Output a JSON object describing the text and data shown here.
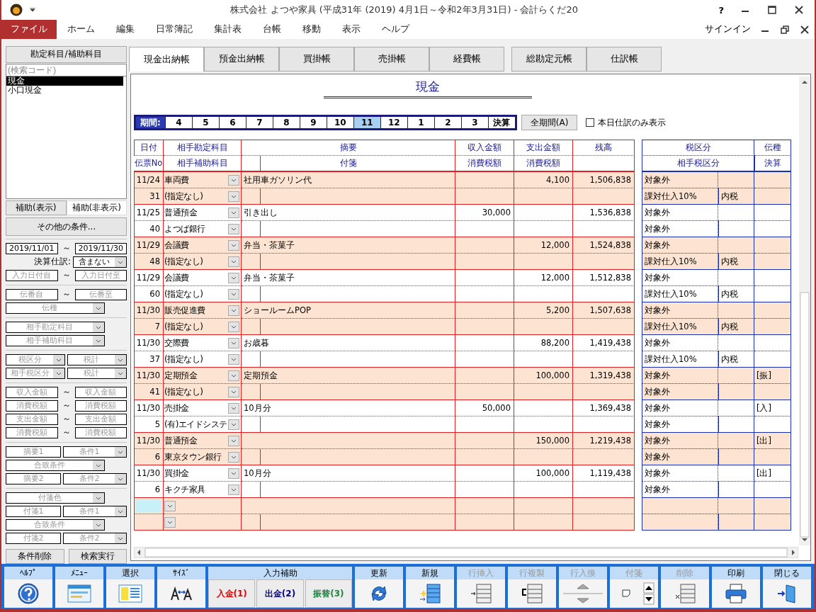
{
  "window": {
    "title": "株式会社 よつや家具 (平成31年 (2019) 4月1日～令和2年3月31日) - 会計らくだ20",
    "help": "?"
  },
  "menu": [
    {
      "label": "ファイル",
      "selected": true
    },
    {
      "label": "ホーム",
      "selected": false
    },
    {
      "label": "編集",
      "selected": false
    },
    {
      "label": "日常簿記",
      "selected": false
    },
    {
      "label": "集計表",
      "selected": false
    },
    {
      "label": "台帳",
      "selected": false
    },
    {
      "label": "移動",
      "selected": false
    },
    {
      "label": "表示",
      "selected": false
    },
    {
      "label": "ヘルプ",
      "selected": false
    }
  ],
  "signin": "サインイン",
  "sidebar": {
    "header": "勘定科目/補助科目",
    "search_placeholder": "(検索コード)",
    "accounts": [
      {
        "label": "現金",
        "selected": true
      },
      {
        "label": "小口現金",
        "selected": false
      }
    ],
    "sub_tabs": [
      {
        "label": "補助(表示)",
        "selected": false
      },
      {
        "label": "補助(非表示)",
        "selected": true
      }
    ],
    "more_button": "その他の条件...",
    "filter_groups": [
      [
        [
          {
            "kind": "date",
            "value": "2019/11/01"
          },
          {
            "kind": "tilde",
            "text": "～"
          },
          {
            "kind": "date",
            "value": "2019/11/30"
          }
        ],
        [
          {
            "kind": "label",
            "text": "決算仕訳:"
          },
          {
            "kind": "combo",
            "value": "含まない"
          }
        ],
        [
          {
            "kind": "text",
            "placeholder": "入力日付自"
          },
          {
            "kind": "tilde",
            "text": "～"
          },
          {
            "kind": "text",
            "placeholder": "入力日付至"
          }
        ]
      ],
      [
        [
          {
            "kind": "text",
            "placeholder": "伝番自"
          },
          {
            "kind": "tilde",
            "text": "～"
          },
          {
            "kind": "text",
            "placeholder": "伝番至"
          }
        ],
        [
          {
            "kind": "combo",
            "placeholder": "伝種"
          }
        ]
      ],
      [
        [
          {
            "kind": "combo",
            "placeholder": "相手勘定科目"
          }
        ],
        [
          {
            "kind": "combo",
            "placeholder": "相手補助科目"
          }
        ]
      ],
      [
        [
          {
            "kind": "combo",
            "placeholder": "税区分"
          },
          {
            "kind": "combo",
            "placeholder": "税計"
          }
        ],
        [
          {
            "kind": "combo",
            "placeholder": "相手税区分"
          },
          {
            "kind": "combo",
            "placeholder": "税計"
          }
        ]
      ],
      [
        [
          {
            "kind": "text",
            "placeholder": "収入金額"
          },
          {
            "kind": "tilde",
            "text": "～"
          },
          {
            "kind": "text",
            "placeholder": "収入金額"
          }
        ],
        [
          {
            "kind": "text",
            "placeholder": "消費税額"
          },
          {
            "kind": "tilde",
            "text": "～"
          },
          {
            "kind": "text",
            "placeholder": "消費税額"
          }
        ],
        [
          {
            "kind": "text",
            "placeholder": "支出金額"
          },
          {
            "kind": "tilde",
            "text": "～"
          },
          {
            "kind": "text",
            "placeholder": "支出金額"
          }
        ],
        [
          {
            "kind": "text",
            "placeholder": "消費税額"
          },
          {
            "kind": "tilde",
            "text": "～"
          },
          {
            "kind": "text",
            "placeholder": "消費税額"
          }
        ]
      ],
      [
        [
          {
            "kind": "text",
            "placeholder": "摘要1"
          },
          {
            "kind": "combo",
            "placeholder": "条件1"
          }
        ],
        [
          {
            "kind": "combo",
            "placeholder": "合致条件"
          }
        ],
        [
          {
            "kind": "text",
            "placeholder": "摘要2"
          },
          {
            "kind": "combo",
            "placeholder": "条件2"
          }
        ]
      ],
      [
        [
          {
            "kind": "combo",
            "placeholder": "付箋色"
          }
        ],
        [
          {
            "kind": "text",
            "placeholder": "付箋1"
          },
          {
            "kind": "combo",
            "placeholder": "条件1"
          }
        ],
        [
          {
            "kind": "combo",
            "placeholder": "合致条件"
          }
        ],
        [
          {
            "kind": "text",
            "placeholder": "付箋2"
          },
          {
            "kind": "combo",
            "placeholder": "条件2"
          }
        ]
      ]
    ],
    "buttons": [
      "条件削除",
      "検索実行"
    ]
  },
  "ledger_tabs": [
    [
      {
        "label": "現金出納帳",
        "selected": true
      },
      {
        "label": "預金出納帳",
        "selected": false
      },
      {
        "label": "買掛帳",
        "selected": false
      },
      {
        "label": "売掛帳",
        "selected": false
      },
      {
        "label": "経費帳",
        "selected": false
      }
    ],
    [
      {
        "label": "総勘定元帳",
        "selected": false
      },
      {
        "label": "仕訳帳",
        "selected": false
      }
    ]
  ],
  "ledger_title": "現金",
  "period": {
    "label": "期間:",
    "months": [
      {
        "label": "4",
        "selected": false
      },
      {
        "label": "5",
        "selected": false
      },
      {
        "label": "6",
        "selected": false
      },
      {
        "label": "7",
        "selected": false
      },
      {
        "label": "8",
        "selected": false
      },
      {
        "label": "9",
        "selected": false
      },
      {
        "label": "10",
        "selected": false
      },
      {
        "label": "11",
        "selected": true
      },
      {
        "label": "12",
        "selected": false
      },
      {
        "label": "1",
        "selected": false
      },
      {
        "label": "2",
        "selected": false
      },
      {
        "label": "3",
        "selected": false
      },
      {
        "label": "決算",
        "selected": false
      }
    ],
    "all_button": "全期間(A)",
    "today_only": {
      "label": "本日仕訳のみ表示",
      "checked": false
    }
  },
  "table": {
    "header_top": [
      "日付",
      "相手勘定科目",
      "摘要",
      "収入金額",
      "支出金額",
      "残高"
    ],
    "header_bottom": [
      "伝票No",
      "相手補助科目",
      "付箋",
      "消費税額",
      "消費税額"
    ],
    "tax_header_top": [
      "税区分",
      "伝種"
    ],
    "tax_header_bottom": [
      "相手税区分",
      "決算"
    ],
    "rows": [
      {
        "date": "11/24",
        "slip_no": "31",
        "account": "車両費",
        "sub_account": "(指定なし)",
        "description": "社用車ガソリン代",
        "expense": "4,100",
        "balance": "1,506,838",
        "tax_class": "対象外",
        "partner_tax_class": "課対仕入10%",
        "tax_method": "内税"
      },
      {
        "date": "11/25",
        "slip_no": "40",
        "account": "普通預金",
        "sub_account": "よつば銀行",
        "description": "引き出し",
        "income": "30,000",
        "balance": "1,536,838",
        "tax_class": "対象外",
        "partner_tax_class": "対象外"
      },
      {
        "date": "11/29",
        "slip_no": "48",
        "account": "会議費",
        "sub_account": "(指定なし)",
        "description": "弁当・茶菓子",
        "expense": "12,000",
        "balance": "1,524,838",
        "tax_class": "対象外",
        "partner_tax_class": "課対仕入10%",
        "tax_method": "内税"
      },
      {
        "date": "11/29",
        "slip_no": "60",
        "account": "会議費",
        "sub_account": "(指定なし)",
        "description": "弁当・茶菓子",
        "expense": "12,000",
        "balance": "1,512,838",
        "tax_class": "対象外",
        "partner_tax_class": "課対仕入10%",
        "tax_method": "内税"
      },
      {
        "date": "11/30",
        "slip_no": "7",
        "account": "販売促進費",
        "sub_account": "(指定なし)",
        "description": "ショールームPOP",
        "expense": "5,200",
        "balance": "1,507,638",
        "tax_class": "対象外",
        "partner_tax_class": "課対仕入10%",
        "tax_method": "内税"
      },
      {
        "date": "11/30",
        "slip_no": "37",
        "account": "交際費",
        "sub_account": "(指定なし)",
        "description": "お歳暮",
        "expense": "88,200",
        "balance": "1,419,438",
        "tax_class": "対象外",
        "partner_tax_class": "課対仕入10%",
        "tax_method": "内税"
      },
      {
        "date": "11/30",
        "slip_no": "41",
        "account": "定期預金",
        "sub_account": "(指定なし)",
        "description": "定期預金",
        "expense": "100,000",
        "balance": "1,319,438",
        "tax_class": "対象外",
        "partner_tax_class": "対象外",
        "voucher_type": "[振]"
      },
      {
        "date": "11/30",
        "slip_no": "5",
        "account": "売掛金",
        "sub_account": "(有)エイドシステ",
        "description": "10月分",
        "income": "50,000",
        "balance": "1,369,438",
        "tax_class": "対象外",
        "partner_tax_class": "対象外",
        "voucher_type": "[入]"
      },
      {
        "date": "11/30",
        "slip_no": "6",
        "account": "普通預金",
        "sub_account": "東京タウン銀行",
        "expense": "150,000",
        "balance": "1,219,438",
        "tax_class": "対象外",
        "partner_tax_class": "対象外",
        "voucher_type": "[出]"
      },
      {
        "date": "11/30",
        "slip_no": "6",
        "account": "買掛金",
        "sub_account": "キクチ家具",
        "description": "10月分",
        "expense": "100,000",
        "balance": "1,119,438",
        "tax_class": "対象外",
        "partner_tax_class": "対象外",
        "voucher_type": "[出]"
      }
    ]
  },
  "toolbar": [
    {
      "label": "ﾍﾙﾌﾟ",
      "kind": "help",
      "disabled": false
    },
    {
      "label": "ﾒﾆｭｰ",
      "kind": "menu",
      "disabled": false
    },
    {
      "label": "選択",
      "kind": "select",
      "disabled": false
    },
    {
      "label": "ｻｲｽﾞ",
      "kind": "size",
      "disabled": false
    },
    {
      "label": "入力補助",
      "kind": "entry",
      "buttons": [
        {
          "label": "入金(1)",
          "color": "#e00000"
        },
        {
          "label": "出金(2)",
          "color": "#000080"
        },
        {
          "label": "振替(3)",
          "color": "#208040"
        }
      ]
    },
    {
      "label": "更新",
      "kind": "refresh",
      "disabled": false
    },
    {
      "label": "新規",
      "kind": "new",
      "disabled": false
    },
    {
      "label": "行挿入",
      "kind": "insert",
      "disabled": true
    },
    {
      "label": "行複製",
      "kind": "duplicate",
      "disabled": true
    },
    {
      "label": "行入換",
      "kind": "swap",
      "disabled": true
    },
    {
      "label": "付箋",
      "kind": "sticky",
      "disabled": true
    },
    {
      "label": "削除",
      "kind": "delete",
      "disabled": true
    },
    {
      "label": "印刷",
      "kind": "print",
      "disabled": false
    },
    {
      "label": "閉じる",
      "kind": "close",
      "disabled": false
    }
  ]
}
